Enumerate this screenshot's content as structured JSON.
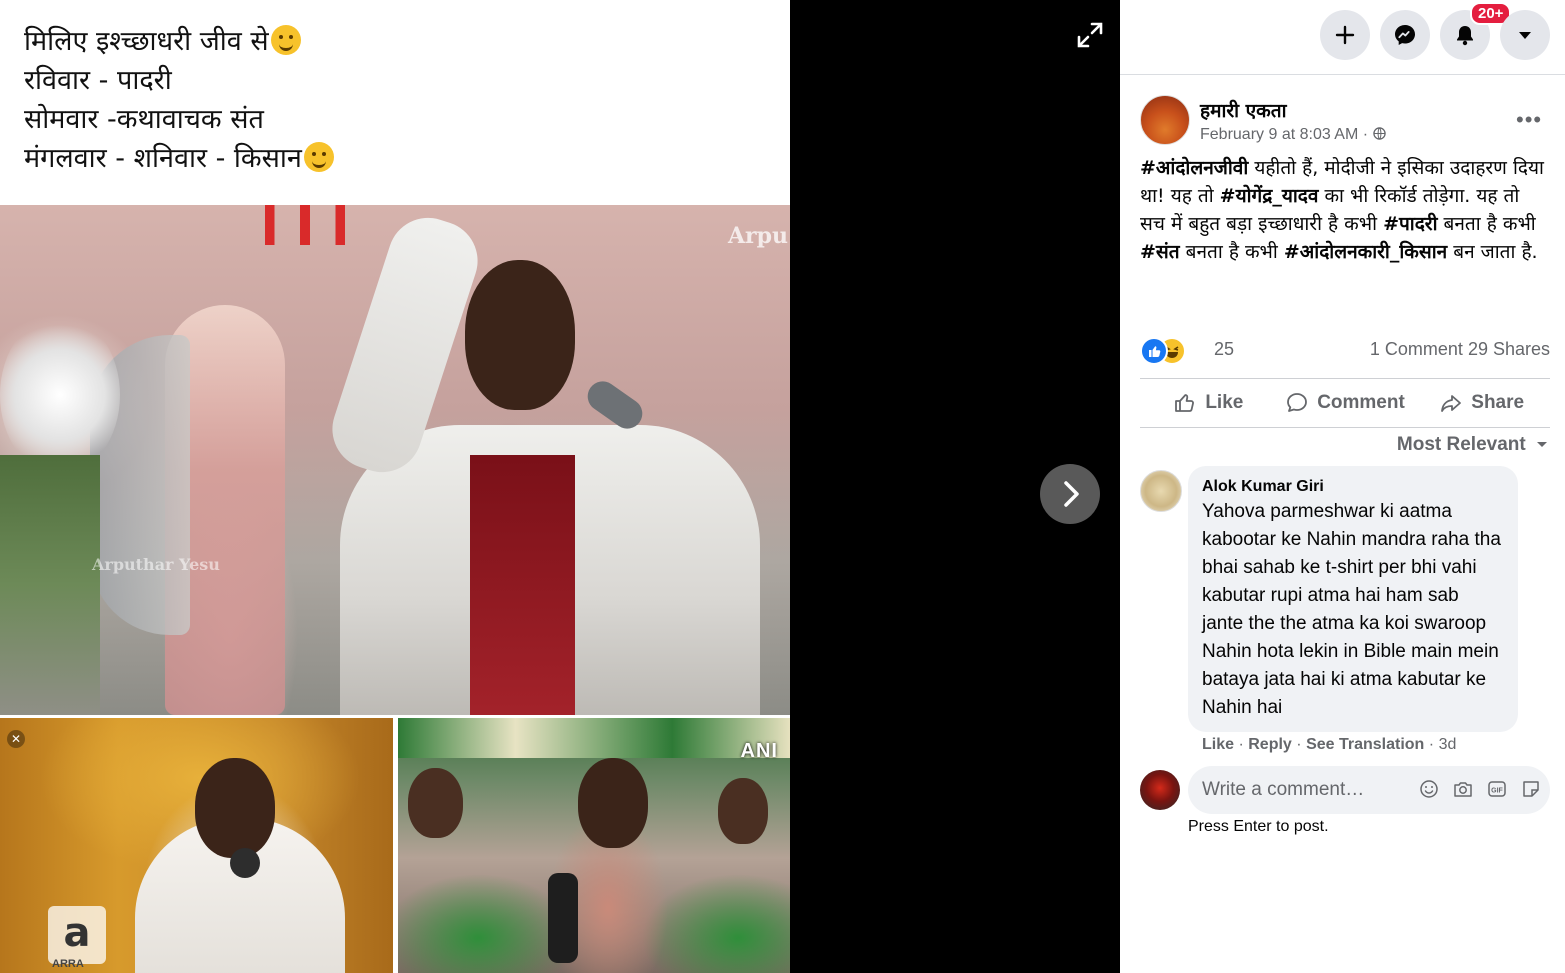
{
  "photo": {
    "caption_lines": [
      "मिलिए इश्च्छाधरी जीव से",
      "रविवार - पादरी",
      "सोमवार -कथावाचक संत",
      "मंगलवार - शनिवार - किसान"
    ],
    "watermark_top": "Arpu",
    "watermark_mid": "Arputhar Yesu",
    "badge_bottom_left": "ARRA",
    "badge_bottom_right": "ANI"
  },
  "topbar": {
    "icons": [
      "plus-icon",
      "messenger-icon",
      "bell-icon",
      "caret-down-icon"
    ],
    "notification_count": "20+"
  },
  "post": {
    "page_name": "हमारी एकता",
    "timestamp": "February 9 at 8:03 AM",
    "more": "•••",
    "text_segments": [
      {
        "t": "#आंदोलनजीवी",
        "b": true
      },
      {
        "t": " यहीतो हैं, मोदीजी ने इसिका उदाहरण दिया था! यह तो ",
        "b": false
      },
      {
        "t": "#योगेंद्र_यादव",
        "b": true
      },
      {
        "t": " का भी रिकॉर्ड तोड़ेगा. यह तो सच में बहुत बड़ा इच्छाधारी है कभी ",
        "b": false
      },
      {
        "t": "#पादरी",
        "b": true
      },
      {
        "t": " बनता है कभी ",
        "b": false
      },
      {
        "t": "#संत",
        "b": true
      },
      {
        "t": " बनता है कभी ",
        "b": false
      },
      {
        "t": "#आंदोलनकारी_किसान",
        "b": true
      },
      {
        "t": " बन जाता है.",
        "b": false
      }
    ],
    "reaction_count": "25",
    "comments_label": "1 Comment",
    "shares_label": "29 Shares"
  },
  "actions": {
    "like": "Like",
    "comment": "Comment",
    "share": "Share"
  },
  "sort": {
    "label": "Most Relevant"
  },
  "comment": {
    "name": "Alok Kumar Giri",
    "text": "Yahova parmeshwar ki aatma kabootar ke Nahin mandra raha tha bhai sahab ke t-shirt per bhi vahi kabutar rupi atma hai ham sab jante the the atma ka koi swaroop Nahin hota lekin in Bible main mein bataya jata hai ki atma kabutar ke Nahin hai",
    "like": "Like",
    "reply": "Reply",
    "see_translation": "See Translation",
    "age": "3d"
  },
  "composer": {
    "placeholder": "Write a comment…",
    "hint": "Press Enter to post."
  },
  "colors": {
    "accent": "#1877f2",
    "notification": "#e41e3f",
    "bubble": "#f0f2f5",
    "muted": "#65676b"
  }
}
